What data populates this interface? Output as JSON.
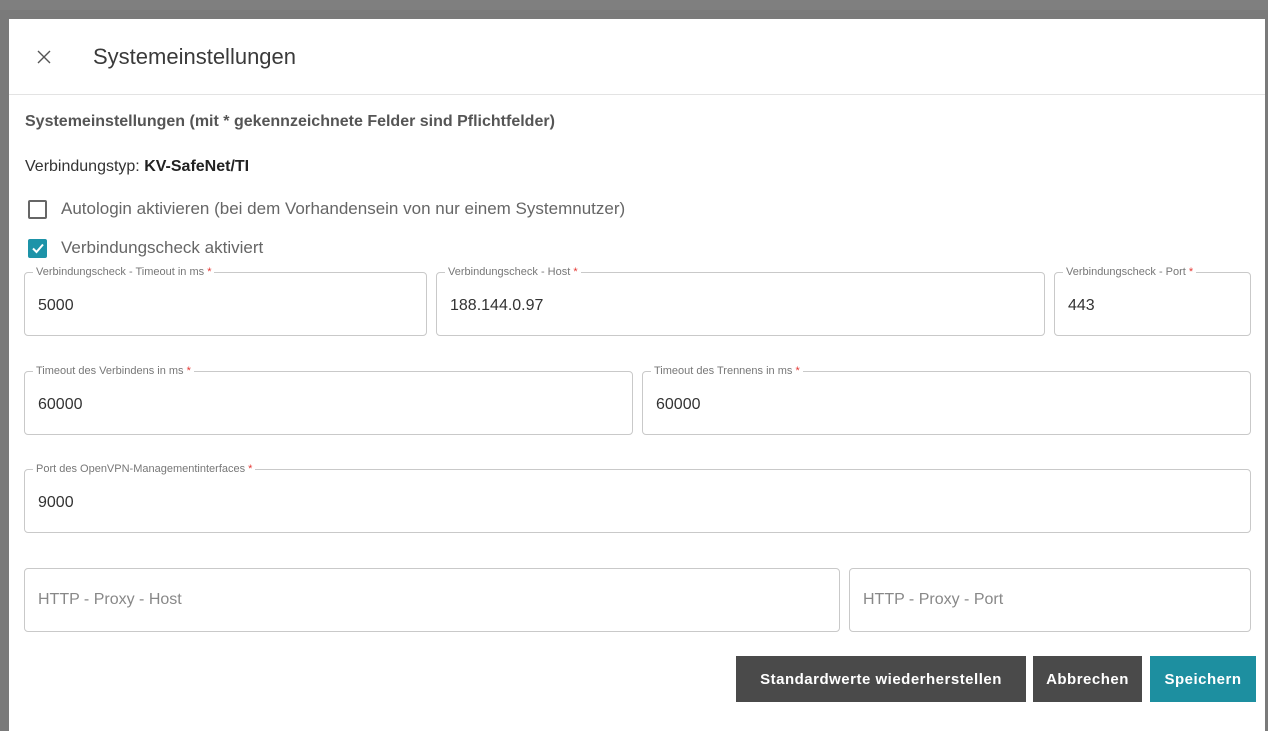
{
  "dialog": {
    "title": "Systemeinstellungen",
    "close_icon": "close-icon"
  },
  "form": {
    "heading": "Systemeinstellungen (mit * gekennzeichnete Felder sind Pflichtfelder)",
    "connection_type_label": "Verbindungstyp:",
    "connection_type_value": "KV-SafeNet/TI",
    "autologin": {
      "label": "Autologin aktivieren (bei dem Vorhandensein von nur einem Systemnutzer)",
      "checked": false
    },
    "connection_check": {
      "label": "Verbindungscheck aktiviert",
      "checked": true
    },
    "fields": {
      "check_timeout": {
        "label": "Verbindungscheck - Timeout in ms",
        "required_mark": "*",
        "value": "5000"
      },
      "check_host": {
        "label": "Verbindungscheck - Host",
        "required_mark": "*",
        "value": "188.144.0.97"
      },
      "check_port": {
        "label": "Verbindungscheck - Port",
        "required_mark": "*",
        "value": "443"
      },
      "connect_timeout": {
        "label": "Timeout des Verbindens in ms",
        "required_mark": "*",
        "value": "60000"
      },
      "disconnect_timeout": {
        "label": "Timeout des Trennens in ms",
        "required_mark": "*",
        "value": "60000"
      },
      "openvpn_port": {
        "label": "Port des OpenVPN-Managementinterfaces",
        "required_mark": "*",
        "value": "9000"
      },
      "proxy_host": {
        "placeholder": "HTTP - Proxy - Host",
        "value": ""
      },
      "proxy_port": {
        "placeholder": "HTTP - Proxy - Port",
        "value": ""
      }
    }
  },
  "buttons": {
    "reset_label": "Standardwerte wiederherstellen",
    "cancel_label": "Abbrechen",
    "save_label": "Speichern"
  },
  "colors": {
    "accent": "#1d8fa0",
    "dark_button": "#4a4a4a",
    "required": "#e53935"
  }
}
